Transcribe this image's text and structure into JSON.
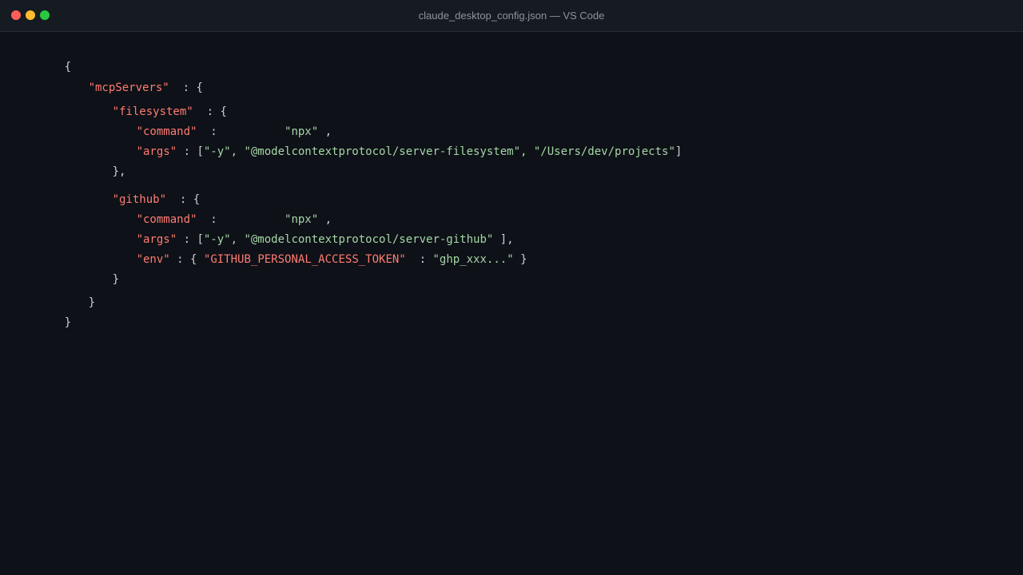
{
  "window": {
    "title": "claude_desktop_config.json — VS Code"
  },
  "colors": {
    "close": "#ff5f57",
    "minimize": "#febc2e",
    "zoom": "#28c840",
    "key": "#ff7b72",
    "string": "#a5d6a7"
  },
  "code": {
    "open_brace": "{",
    "mcp_key": "\"mcpServers\"",
    "fs_key": "\"filesystem\"",
    "fs_command_key": "\"command\"",
    "fs_command_value": "\"npx\"",
    "fs_args_key": "\"args\"",
    "fs_args_values": "\"-y\", \"@modelcontextprotocol/server-filesystem\", \"/Users/dev/projects\"",
    "fs_close": "},",
    "gh_key": "\"github\"",
    "gh_command_key": "\"command\"",
    "gh_command_value": "\"npx\"",
    "gh_args_key": "\"args\"",
    "gh_args_values": "\"-y\", \"@modelcontextprotocol/server-github\"",
    "gh_env_key": "\"env\"",
    "gh_env_token_key": "\"GITHUB_PERSONAL_ACCESS_TOKEN\"",
    "gh_env_token_value": "\"ghp_xxx...\"",
    "gh_close": "}",
    "mcp_close": "}",
    "close_brace": "}"
  }
}
